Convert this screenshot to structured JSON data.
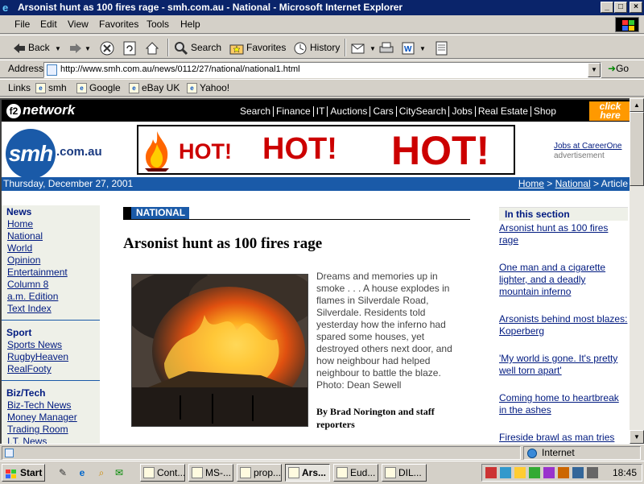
{
  "window": {
    "title": "Arsonist hunt as 100 fires rage - smh.com.au - National - Microsoft Internet Explorer",
    "min_label": "_",
    "max_label": "□",
    "close_label": "×"
  },
  "menu": {
    "items": [
      "File",
      "Edit",
      "View",
      "Favorites",
      "Tools",
      "Help"
    ]
  },
  "toolbar": {
    "back": "Back",
    "search": "Search",
    "favorites": "Favorites",
    "history": "History"
  },
  "address": {
    "label": "Address",
    "url": "http://www.smh.com.au/news/0112/27/national/national1.html",
    "go": "Go"
  },
  "links": {
    "label": "Links",
    "items": [
      "smh",
      "Google",
      "eBay UK",
      "Yahoo!"
    ]
  },
  "site": {
    "network_logo": "network",
    "network_logo_prefix": "f2",
    "network_nav": [
      "Search",
      "Finance",
      "IT",
      "Auctions",
      "Cars",
      "CitySearch",
      "Jobs",
      "Real Estate",
      "Shop"
    ],
    "click_here": "click here",
    "logo": "smh",
    "logo_domain": ".com.au",
    "banner_words": [
      "HOT!",
      "HOT!",
      "HOT!"
    ],
    "jobs_link": "Jobs at CareerOne",
    "advertisement": "advertisement",
    "date": "Thursday, December 27, 2001",
    "breadcrumb": {
      "home": "Home",
      "sep1": " > ",
      "section": "National",
      "sep2": " > ",
      "current": "Article"
    }
  },
  "leftnav": {
    "news_header": "News",
    "news_items": [
      "Home",
      "National",
      "World",
      "Opinion",
      "Entertainment",
      "Column 8",
      "a.m. Edition",
      "Text Index"
    ],
    "sport_header": "Sport",
    "sport_items": [
      "Sports News",
      "RugbyHeaven",
      "RealFooty"
    ],
    "biztech_header": "Biz/Tech",
    "biztech_items": [
      "Biz-Tech News",
      "Money Manager",
      "Trading Room",
      "I.T. News"
    ]
  },
  "article": {
    "section_label": "NATIONAL",
    "headline": "Arsonist hunt as 100 fires rage",
    "caption": "Dreams and memories up in smoke . . . A house explodes in flames in Silverdale Road, Silverdale. Residents told yesterday how the inferno had spared some houses, yet destroyed others next door, and how neighbour had helped neighbour to battle the blaze. Photo: Dean Sewell",
    "byline": "By Brad Norington and staff reporters"
  },
  "in_section": {
    "title": "In this section",
    "links": [
      "Arsonist hunt as 100 fires rage",
      "One man and a cigarette lighter, and a deadly mountain inferno",
      "Arsonists behind most blazes: Koperberg",
      "'My world is gone. It's pretty well torn apart'",
      "Coming home to heartbreak in the ashes",
      "Fireside brawl as man tries"
    ]
  },
  "status": {
    "zone": "Internet"
  },
  "taskbar": {
    "start": "Start",
    "tasks": [
      "Cont...",
      "MS-...",
      "prop...",
      "Ars...",
      "Eud...",
      "DIL..."
    ],
    "active_index": 3,
    "clock": "18:45"
  },
  "colors": {
    "title_bar": "#0a246a",
    "smh_blue": "#1a5aa8",
    "link": "#001a80",
    "hot_red": "#c00000",
    "click_orange": "#ff9900"
  }
}
